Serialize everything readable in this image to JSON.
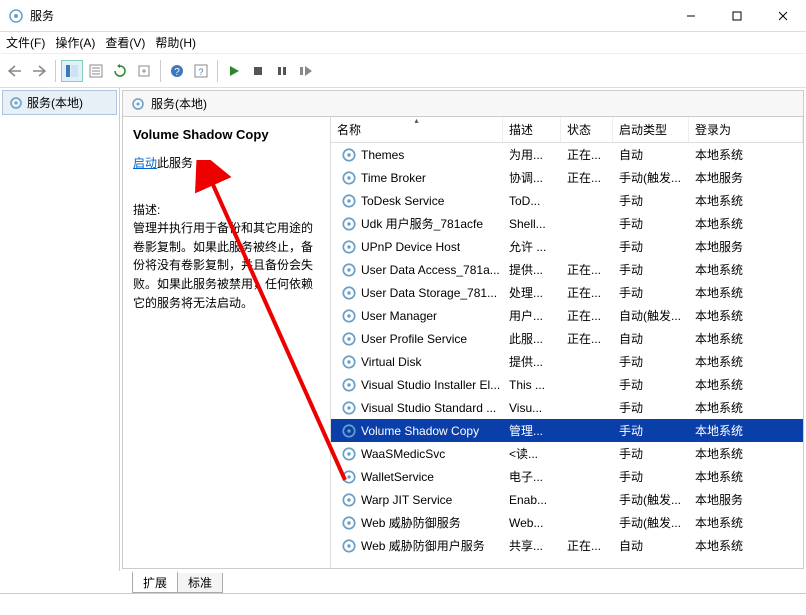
{
  "window": {
    "title": "服务"
  },
  "menu": {
    "file": "文件(F)",
    "action": "操作(A)",
    "view": "查看(V)",
    "help": "帮助(H)"
  },
  "nav": {
    "local_services": "服务(本地)"
  },
  "pane_header": "服务(本地)",
  "detail": {
    "title": "Volume Shadow Copy",
    "start_link": "启动",
    "start_suffix": "此服务",
    "desc_label": "描述:",
    "description": "管理并执行用于备份和其它用途的卷影复制。如果此服务被终止，备份将没有卷影复制，并且备份会失败。如果此服务被禁用，任何依赖它的服务将无法启动。"
  },
  "columns": {
    "name": "名称",
    "desc": "描述",
    "status": "状态",
    "start_type": "启动类型",
    "logon": "登录为"
  },
  "tabs": {
    "extended": "扩展",
    "standard": "标准"
  },
  "services": [
    {
      "name": "Themes",
      "desc": "为用...",
      "status": "正在...",
      "start": "自动",
      "logon": "本地系统",
      "selected": false
    },
    {
      "name": "Time Broker",
      "desc": "协调...",
      "status": "正在...",
      "start": "手动(触发...",
      "logon": "本地服务",
      "selected": false
    },
    {
      "name": "ToDesk Service",
      "desc": "ToD...",
      "status": "",
      "start": "手动",
      "logon": "本地系统",
      "selected": false
    },
    {
      "name": "Udk 用户服务_781acfe",
      "desc": "Shell...",
      "status": "",
      "start": "手动",
      "logon": "本地系统",
      "selected": false
    },
    {
      "name": "UPnP Device Host",
      "desc": "允许 ...",
      "status": "",
      "start": "手动",
      "logon": "本地服务",
      "selected": false
    },
    {
      "name": "User Data Access_781a...",
      "desc": "提供...",
      "status": "正在...",
      "start": "手动",
      "logon": "本地系统",
      "selected": false
    },
    {
      "name": "User Data Storage_781...",
      "desc": "处理...",
      "status": "正在...",
      "start": "手动",
      "logon": "本地系统",
      "selected": false
    },
    {
      "name": "User Manager",
      "desc": "用户...",
      "status": "正在...",
      "start": "自动(触发...",
      "logon": "本地系统",
      "selected": false
    },
    {
      "name": "User Profile Service",
      "desc": "此服...",
      "status": "正在...",
      "start": "自动",
      "logon": "本地系统",
      "selected": false
    },
    {
      "name": "Virtual Disk",
      "desc": "提供...",
      "status": "",
      "start": "手动",
      "logon": "本地系统",
      "selected": false
    },
    {
      "name": "Visual Studio Installer El...",
      "desc": "This ...",
      "status": "",
      "start": "手动",
      "logon": "本地系统",
      "selected": false
    },
    {
      "name": "Visual Studio Standard ...",
      "desc": "Visu...",
      "status": "",
      "start": "手动",
      "logon": "本地系统",
      "selected": false
    },
    {
      "name": "Volume Shadow Copy",
      "desc": "管理...",
      "status": "",
      "start": "手动",
      "logon": "本地系统",
      "selected": true
    },
    {
      "name": "WaaSMedicSvc",
      "desc": "<读...",
      "status": "",
      "start": "手动",
      "logon": "本地系统",
      "selected": false
    },
    {
      "name": "WalletService",
      "desc": "电子...",
      "status": "",
      "start": "手动",
      "logon": "本地系统",
      "selected": false
    },
    {
      "name": "Warp JIT Service",
      "desc": "Enab...",
      "status": "",
      "start": "手动(触发...",
      "logon": "本地服务",
      "selected": false
    },
    {
      "name": "Web 威胁防御服务",
      "desc": "Web...",
      "status": "",
      "start": "手动(触发...",
      "logon": "本地系统",
      "selected": false
    },
    {
      "name": "Web 威胁防御用户服务",
      "desc": "共享...",
      "status": "正在...",
      "start": "自动",
      "logon": "本地系统",
      "selected": false
    }
  ]
}
